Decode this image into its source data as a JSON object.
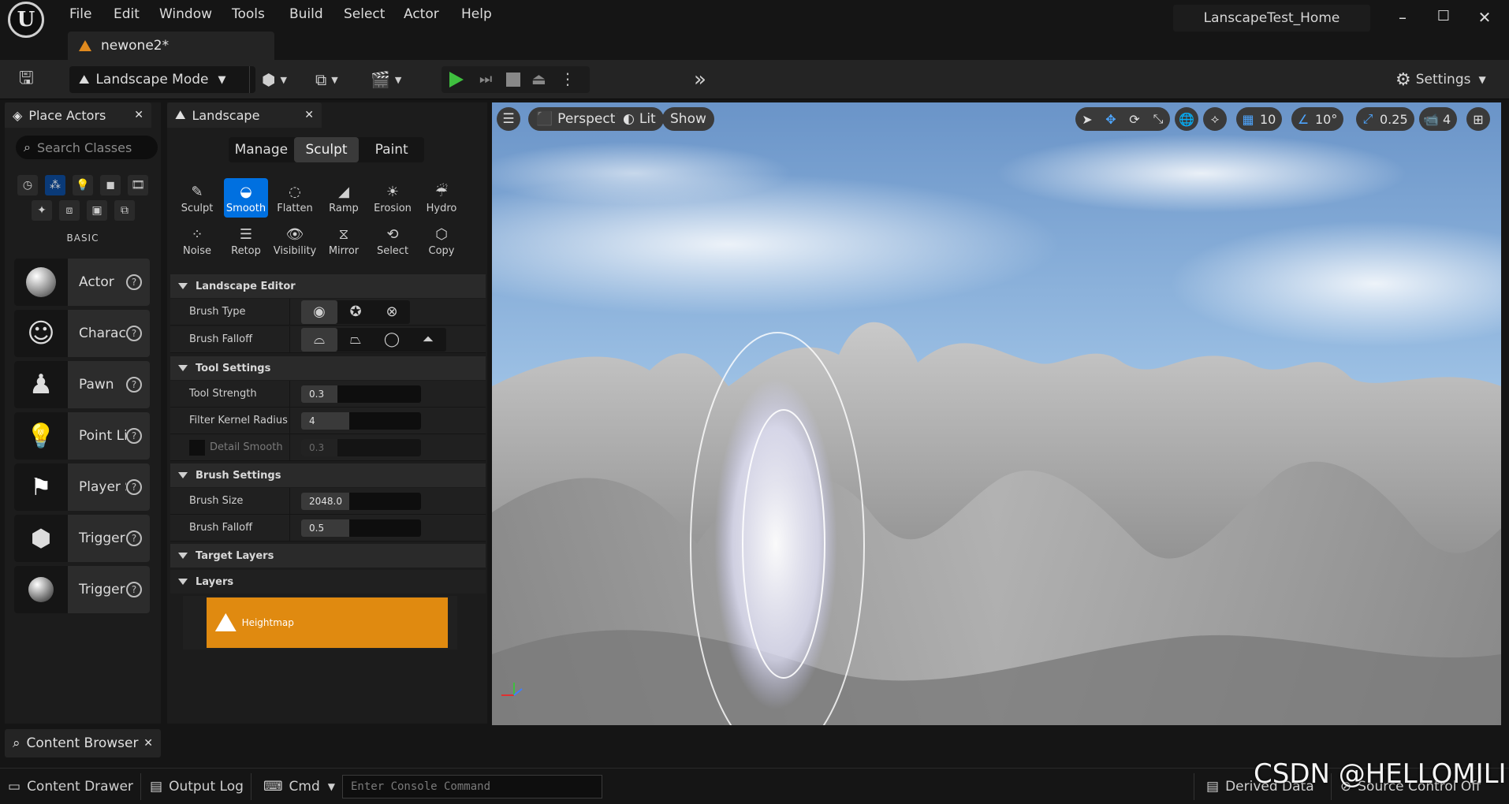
{
  "menu": [
    "File",
    "Edit",
    "Window",
    "Tools",
    "Build",
    "Select",
    "Actor",
    "Help"
  ],
  "project_name": "LanscapeTest_Home",
  "document_tab": "newone2*",
  "toolbar": {
    "mode": "Landscape Mode",
    "settings": "Settings"
  },
  "place_actors": {
    "title": "Place Actors",
    "search_placeholder": "Search Classes",
    "category": "BASIC",
    "items": [
      "Actor",
      "Character",
      "Pawn",
      "Point Light",
      "Player Start",
      "Trigger Box",
      "Trigger Sphere"
    ]
  },
  "landscape": {
    "title": "Landscape",
    "modes": [
      "Manage",
      "Sculpt",
      "Paint"
    ],
    "selected_mode": "Sculpt",
    "tools": [
      "Sculpt",
      "Smooth",
      "Flatten",
      "Ramp",
      "Erosion",
      "Hydro",
      "Noise",
      "Retop",
      "Visibility",
      "Mirror",
      "Select",
      "Copy"
    ],
    "selected_tool": "Smooth",
    "sections": {
      "editor": "Landscape Editor",
      "tool_settings": "Tool Settings",
      "brush_settings": "Brush Settings",
      "target_layers": "Target Layers"
    },
    "brush_type_label": "Brush Type",
    "brush_falloff_type_label": "Brush Falloff",
    "tool_strength": {
      "label": "Tool Strength",
      "value": "0.3",
      "fraction": 0.3
    },
    "filter_kernel_radius": {
      "label": "Filter Kernel Radius",
      "value": "4",
      "fraction": 0.4
    },
    "detail_smooth": {
      "label": "Detail Smooth",
      "value": "0.3",
      "fraction": 0.3
    },
    "brush_size": {
      "label": "Brush Size",
      "value": "2048.0",
      "fraction": 0.4
    },
    "brush_falloff": {
      "label": "Brush Falloff",
      "value": "0.5",
      "fraction": 0.4
    },
    "layers_label": "Layers",
    "layer_name": "Heightmap"
  },
  "viewport": {
    "perspective": "Perspective",
    "lit": "Lit",
    "show": "Show",
    "grid_snap": "10",
    "rotation_snap": "10°",
    "scale_snap": "0.25",
    "camera_speed": "4"
  },
  "content_browser": "Content Browser",
  "status": {
    "content_drawer": "Content Drawer",
    "output_log": "Output Log",
    "cmd": "Cmd",
    "console_placeholder": "Enter Console Command",
    "derived_data": "Derived Data",
    "source_control": "Source Control Off"
  },
  "watermark": "CSDN @HELLOMILI",
  "colors": {
    "accent_blue": "#0070e0",
    "heightmap_orange": "#e08a10",
    "play_green": "#3fbf3f"
  }
}
